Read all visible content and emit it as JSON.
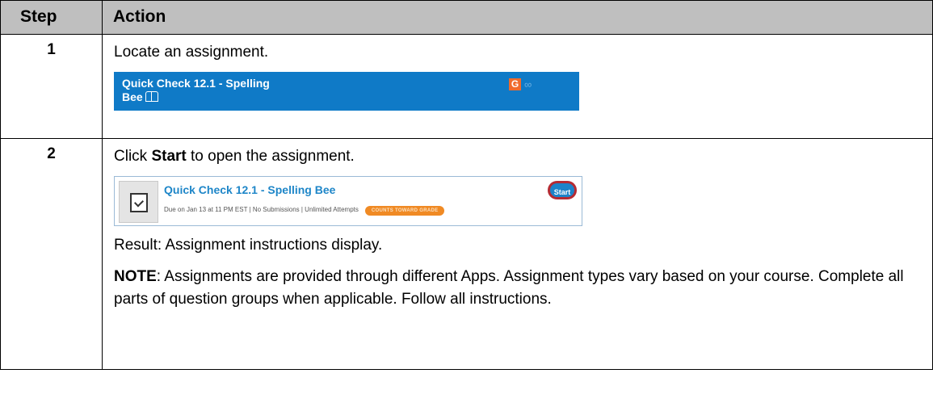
{
  "header": {
    "step_label": "Step",
    "action_label": "Action"
  },
  "rows": [
    {
      "step": "1",
      "instruction": "Locate an assignment.",
      "screenshot": {
        "title_line1": "Quick Check 12.1 - Spelling",
        "title_line2": "Bee",
        "grade_icon_letter": "G",
        "link_glyph": "∞",
        "icons": [
          "book-icon",
          "grade-icon",
          "link-icon"
        ],
        "colors": {
          "background": "#0f7ac7",
          "grade_icon": "#f06b2c"
        }
      }
    },
    {
      "step": "2",
      "instruction_prefix": "Click ",
      "instruction_bold": "Start",
      "instruction_suffix": " to open the assignment.",
      "screenshot": {
        "title": "Quick Check 12.1 - Spelling Bee",
        "meta": "Due on Jan 13 at 11 PM EST  |  No Submissions  |  Unlimited Attempts",
        "badge": "COUNTS TOWARD GRADE",
        "start_button": "Start",
        "icons": [
          "document-check-icon"
        ],
        "colors": {
          "title": "#1e86c8",
          "start_button": "#1d83c9",
          "start_highlight": "#b52b33",
          "badge": "#f08a24"
        }
      },
      "result": "Result: Assignment instructions display.",
      "note_label": "NOTE",
      "note_text": ": Assignments are provided through different Apps. Assignment types vary based on your course. Complete all parts of question groups when applicable. Follow all instructions."
    }
  ]
}
